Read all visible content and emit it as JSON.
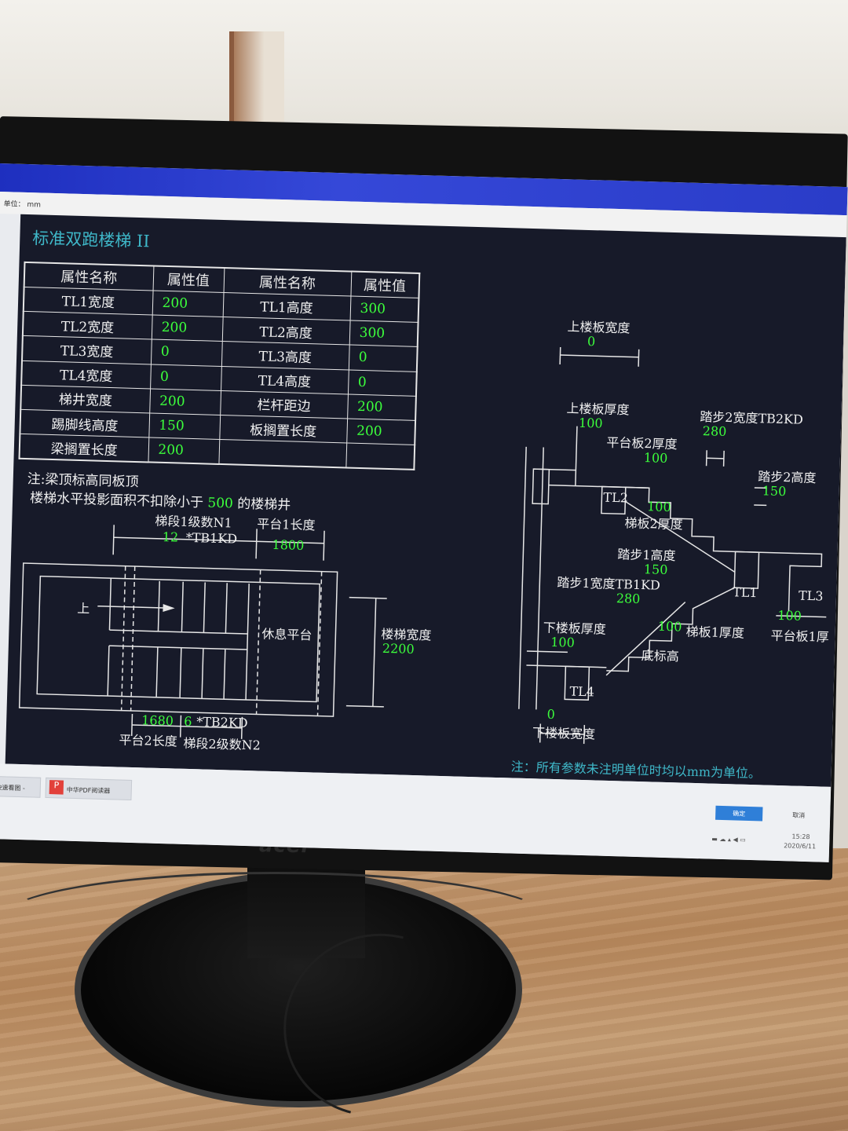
{
  "unit_bar": {
    "label": "单位：",
    "unit": "mm"
  },
  "dialog": {
    "title": "标准双跑楼梯 II",
    "table": {
      "headers": [
        "属性名称",
        "属性值",
        "属性名称",
        "属性值"
      ],
      "rows": [
        [
          "TL1宽度",
          "200",
          "TL1高度",
          "300"
        ],
        [
          "TL2宽度",
          "200",
          "TL2高度",
          "300"
        ],
        [
          "TL3宽度",
          "0",
          "TL3高度",
          "0"
        ],
        [
          "TL4宽度",
          "0",
          "TL4高度",
          "0"
        ],
        [
          "梯井宽度",
          "200",
          "栏杆距边",
          "200"
        ],
        [
          "踢脚线高度",
          "150",
          "板搁置长度",
          "200"
        ],
        [
          "梁搁置长度",
          "200",
          "",
          ""
        ]
      ]
    },
    "note_line1": "注:梁顶标高同板顶",
    "note_line2_prefix": "楼梯水平投影面积不扣除小于",
    "note_line2_value": "500",
    "note_line2_suffix": "的楼梯井",
    "plan": {
      "flight1_label": "梯段1级数N1",
      "flight1_count": "12",
      "flight1_unit": "*TB1KD",
      "platform1_label": "平台1长度",
      "platform1_value": "1800",
      "up_label": "上",
      "rest_label": "休息平台",
      "width_label": "楼梯宽度",
      "width_value": "2200",
      "platform2_value": "1680",
      "flight2_count": "6",
      "flight2_unit": "*TB2KD",
      "platform2_label": "平台2长度",
      "flight2_label": "梯段2级数N2"
    },
    "section": {
      "upper_slab_width_label": "上楼板宽度",
      "upper_slab_width_value": "0",
      "upper_slab_thk_label": "上楼板厚度",
      "upper_slab_thk_value": "100",
      "step2_width_label": "踏步2宽度TB2KD",
      "step2_width_value": "280",
      "platform2_thk_label": "平台板2厚度",
      "platform2_thk_value": "100",
      "step2_height_label": "踏步2高度",
      "step2_height_value": "150",
      "tl2_label": "TL2",
      "flight2_thk_value": "100",
      "flight2_thk_label": "梯板2厚度",
      "step1_height_label": "踏步1高度",
      "step1_height_value": "150",
      "step1_width_label": "踏步1宽度TB1KD",
      "step1_width_value": "280",
      "tl1_label": "TL1",
      "tl3_label": "TL3",
      "lower_slab_thk_label": "下楼板厚度",
      "lower_slab_thk_value": "100",
      "flight1_thk_value": "100",
      "flight1_thk_label": "梯板1厚度",
      "platform1_thk_value": "100",
      "platform1_thk_label": "平台板1厚",
      "bottom_elev_label": "底标高",
      "tl4_label": "TL4",
      "lower_slab_width_value": "0",
      "lower_slab_width_label": "下楼板宽度"
    },
    "footnote": "注：所有参数未注明单位时均以mm为单位。"
  },
  "taskbar": {
    "item1": "AD快速看图 - E...",
    "item2": "中华PDF阅读器",
    "ok_label": "确定",
    "cancel_label": "取消",
    "time": "15:28",
    "date": "2020/6/11"
  },
  "monitor": {
    "brand": "acer"
  },
  "colors": {
    "value_green": "#3cff3c",
    "title_cyan": "#3fb8c9",
    "dialog_bg": "#171a29",
    "titlebar_blue": "#2a3cc8"
  }
}
